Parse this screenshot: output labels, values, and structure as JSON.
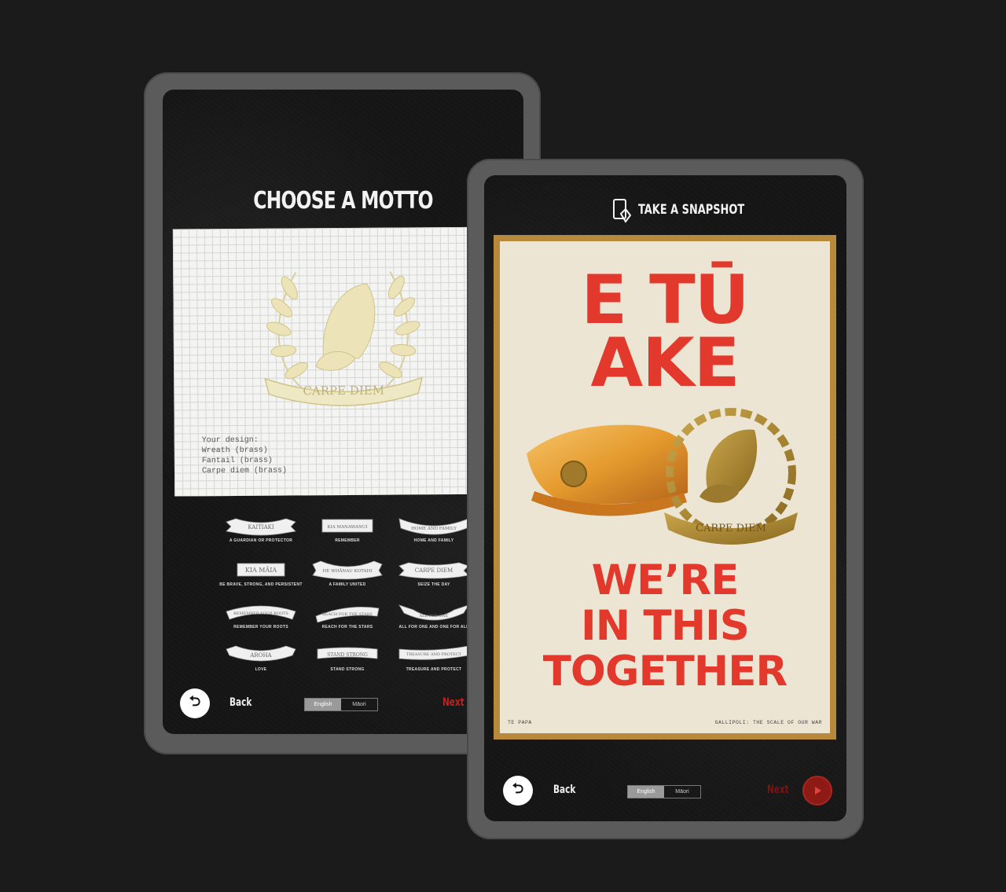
{
  "left_screen": {
    "heading": "CHOOSE A MOTTO",
    "preview_motto": "CARPE DIEM",
    "design_summary": [
      "Your design:",
      "Wreath (brass)",
      "Fantail (brass)",
      "Carpe diem (brass)"
    ],
    "mottos": [
      {
        "ribbon": "KAITIAKI",
        "caption": "A guardian or protector"
      },
      {
        "ribbon": "KIA MANAWANUI",
        "caption": "Remember"
      },
      {
        "ribbon": "HOME AND FAMILY",
        "caption": "Home and family"
      },
      {
        "ribbon": "KIA MĀIA",
        "caption": "Be brave, strong, and persistent"
      },
      {
        "ribbon": "HE WHĀNAU KOTAHI",
        "caption": "A family united"
      },
      {
        "ribbon": "CARPE DIEM",
        "caption": "Seize the day"
      },
      {
        "ribbon": "REMEMBER YOUR ROOTS",
        "caption": "Remember your roots"
      },
      {
        "ribbon": "REACH FOR THE STARS",
        "caption": "Reach for the stars"
      },
      {
        "ribbon": "ALL FOR ONE",
        "caption": "All for one and one for all"
      },
      {
        "ribbon": "AROHA",
        "caption": "Love"
      },
      {
        "ribbon": "STAND STRONG",
        "caption": "Stand strong"
      },
      {
        "ribbon": "TREASURE AND PROTECT",
        "caption": "Treasure and protect"
      }
    ],
    "nav": {
      "back_label": "Back",
      "lang_english": "English",
      "lang_maori": "Māori",
      "next_label": "Next"
    }
  },
  "right_screen": {
    "snapshot_label": "TAKE A SNAPSHOT",
    "poster": {
      "line1": "E TŪ",
      "line2": "AKE",
      "line3": "WE’RE",
      "line4": "IN THIS",
      "line5": "TOGETHER",
      "badge_motto": "CARPE DIEM",
      "footer_left": "TE PAPA",
      "footer_right": "GALLIPOLI: THE SCALE OF OUR WAR"
    },
    "nav": {
      "back_label": "Back",
      "lang_english": "English",
      "lang_maori": "Māori",
      "next_label": "Next"
    }
  },
  "colors": {
    "background": "#1b1b1b",
    "tablet_frame": "#5b5b5b",
    "accent_red": "#e2392c",
    "next_red": "#c0221c",
    "poster_bg": "#ece5d3",
    "brass": "#b7893d"
  }
}
